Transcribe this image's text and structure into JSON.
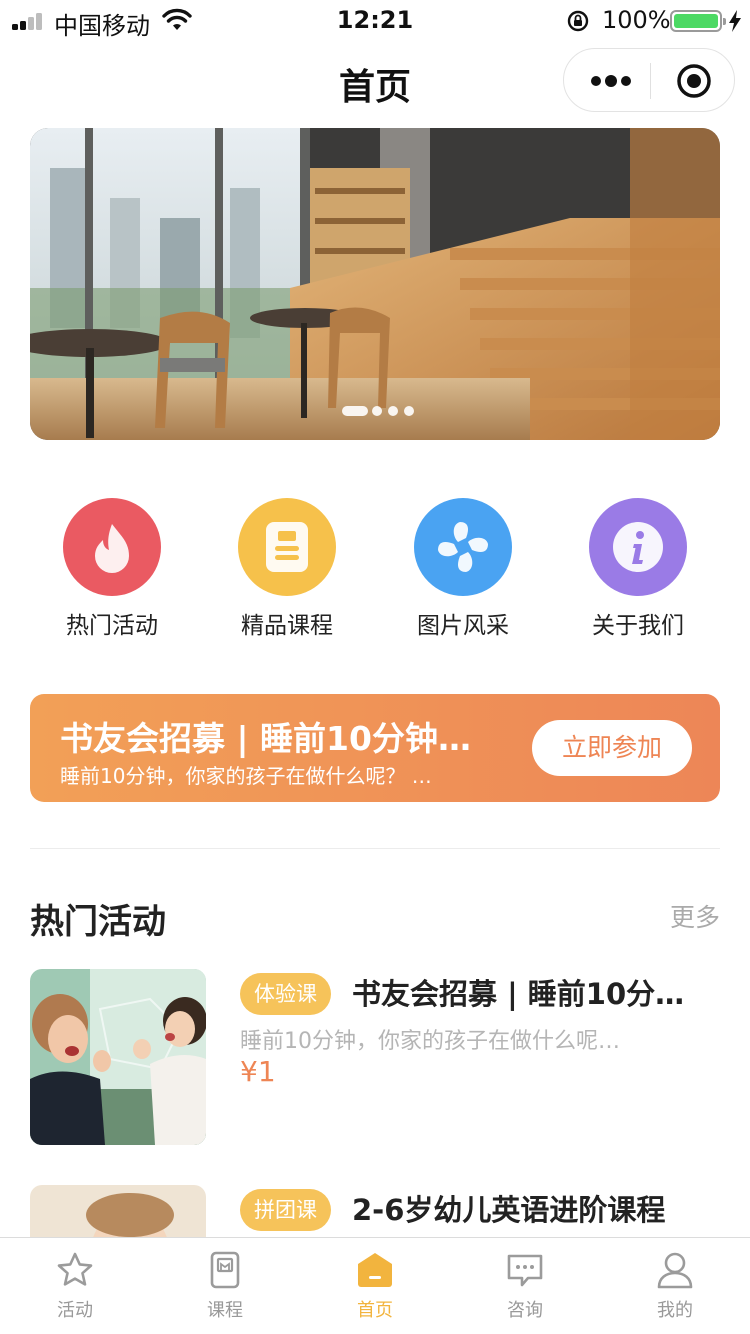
{
  "status_bar": {
    "carrier": "中国移动",
    "time": "12:21",
    "battery": "100%",
    "battery_level": 1.0
  },
  "nav": {
    "title": "首页",
    "capsule_icons": [
      "more-icon",
      "target-icon"
    ]
  },
  "banner": {
    "slide_count": 4,
    "active_index": 0
  },
  "quick_links": [
    {
      "label": "热门活动",
      "icon": "flame-icon",
      "color": "#ea5a62"
    },
    {
      "label": "精品课程",
      "icon": "book-icon",
      "color": "#f6c14b"
    },
    {
      "label": "图片风采",
      "icon": "pinwheel-icon",
      "color": "#4aa3f2"
    },
    {
      "label": "关于我们",
      "icon": "info-icon",
      "color": "#9a7be6"
    }
  ],
  "promo": {
    "title": "书友会招募 | 睡前10分钟…",
    "subtitle": "睡前10分钟，你家的孩子在做什么呢？ …",
    "button": "立即参加"
  },
  "hot_section": {
    "title": "热门活动",
    "more": "更多"
  },
  "items": [
    {
      "tag": "体验课",
      "title": "书友会招募 | 睡前10分…",
      "desc": "睡前10分钟，你家的孩子在做什么呢…",
      "price": "¥1"
    },
    {
      "tag": "拼团课",
      "title": "2-6岁幼儿英语进阶课程"
    }
  ],
  "tabbar": [
    {
      "label": "活动",
      "icon": "star-icon",
      "active": false
    },
    {
      "label": "课程",
      "icon": "course-icon",
      "active": false
    },
    {
      "label": "首页",
      "icon": "home-icon",
      "active": true
    },
    {
      "label": "咨询",
      "icon": "chat-icon",
      "active": false
    },
    {
      "label": "我的",
      "icon": "user-icon",
      "active": false
    }
  ],
  "colors": {
    "accent": "#f2b43e",
    "promo_start": "#f2a057",
    "promo_end": "#ed8657",
    "price": "#ee8554"
  }
}
